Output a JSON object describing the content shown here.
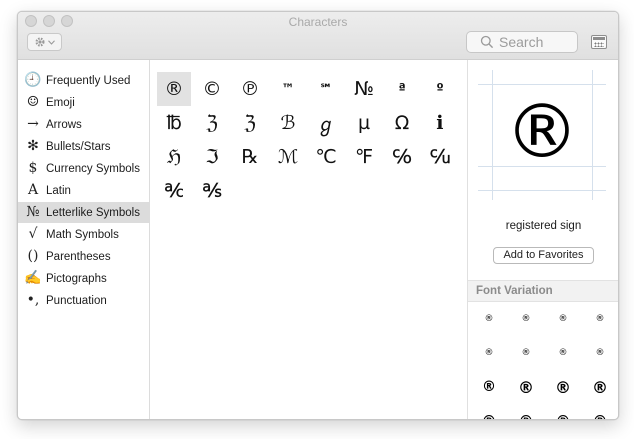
{
  "window": {
    "title": "Characters"
  },
  "toolbar": {
    "search_placeholder": "Search"
  },
  "sidebar": {
    "items": [
      {
        "label": "Frequently Used",
        "icon": "🕘"
      },
      {
        "label": "Emoji",
        "icon": "☺"
      },
      {
        "label": "Arrows",
        "icon": "→"
      },
      {
        "label": "Bullets/Stars",
        "icon": "✻"
      },
      {
        "label": "Currency Symbols",
        "icon": "$"
      },
      {
        "label": "Latin",
        "icon": "A"
      },
      {
        "label": "Letterlike Symbols",
        "icon": "№"
      },
      {
        "label": "Math Symbols",
        "icon": "√"
      },
      {
        "label": "Parentheses",
        "icon": "()"
      },
      {
        "label": "Pictographs",
        "icon": "✍"
      },
      {
        "label": "Punctuation",
        "icon": "•,"
      }
    ],
    "selected": "Letterlike Symbols"
  },
  "grid": {
    "characters": [
      "®",
      "©",
      "℗",
      "™",
      "℠",
      "№",
      "ª",
      "º",
      "℔",
      "ℨ",
      "ℨ",
      "ℬ",
      "ℊ",
      "µ",
      "Ω",
      "ℹ",
      "ℌ",
      "ℑ",
      "℞",
      "ℳ",
      "℃",
      "℉",
      "℅",
      "℆",
      "℀",
      "℁"
    ]
  },
  "inspector": {
    "glyph": "®",
    "name": "registered sign",
    "add_favorites_label": "Add to Favorites",
    "font_variation_label": "Font Variation",
    "variations": [
      "®",
      "®",
      "®",
      "®",
      "®",
      "®",
      "®",
      "®",
      "®",
      "®",
      "®",
      "®",
      "®",
      "®",
      "®",
      "®"
    ]
  }
}
